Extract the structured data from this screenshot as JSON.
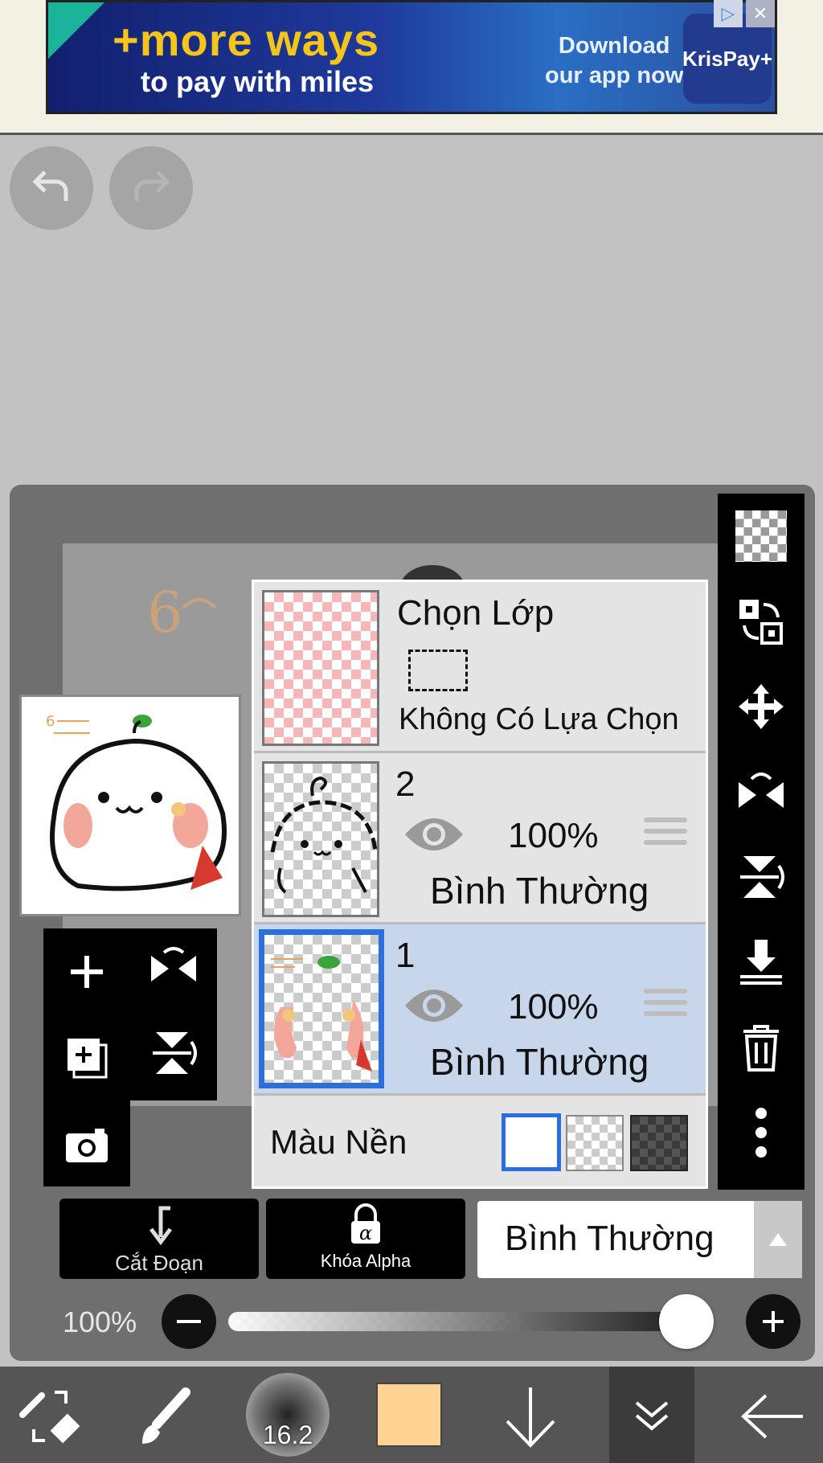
{
  "ad": {
    "headline": "+more ways",
    "subline": "to pay with miles",
    "download_line1": "Download",
    "download_line2": "our app now",
    "brand": "KrisPay+"
  },
  "layers_panel": {
    "selection_layer": {
      "title": "Chọn Lớp",
      "status": "Không Có Lựa Chọn"
    },
    "layers": [
      {
        "name": "2",
        "opacity": "100%",
        "blend_mode": "Bình Thường",
        "selected": false
      },
      {
        "name": "1",
        "opacity": "100%",
        "blend_mode": "Bình Thường",
        "selected": true
      }
    ],
    "background": {
      "label": "Màu Nền",
      "options": [
        "white",
        "transparent",
        "dark"
      ],
      "selected": "white"
    }
  },
  "controls": {
    "clipping_label": "Cắt Đoạn",
    "alpha_lock_label": "Khóa Alpha",
    "blend_mode_value": "Bình Thường",
    "opacity_value": "100%",
    "opacity_fraction": 1.0
  },
  "bottom_toolbar": {
    "brush_size": "16.2",
    "current_color": "#FFD394"
  },
  "colors": {
    "selection_blue": "#2a6fdc",
    "selected_row": "#c8d6ec",
    "panel_bg": "#6f6f6f"
  }
}
